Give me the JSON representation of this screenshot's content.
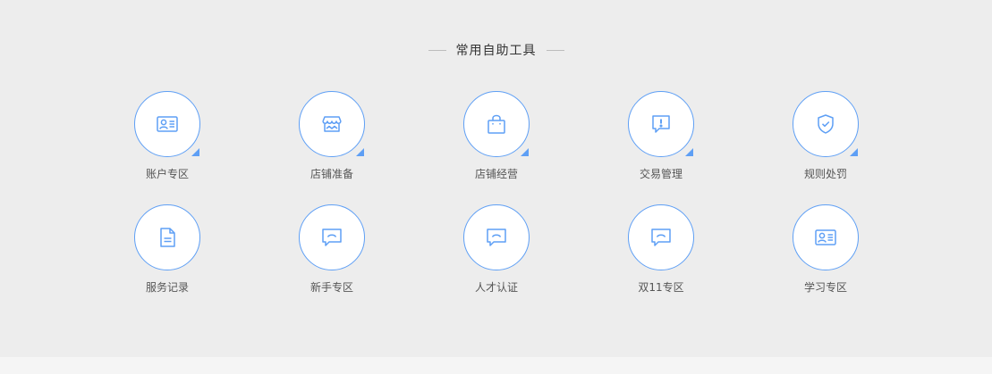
{
  "section": {
    "title": "常用自助工具"
  },
  "colors": {
    "accent": "#5e9ff5",
    "background": "#ededed"
  },
  "tools": [
    {
      "label": "账户专区",
      "icon": "id-card-icon",
      "has_corner": true
    },
    {
      "label": "店铺准备",
      "icon": "storefront-icon",
      "has_corner": true
    },
    {
      "label": "店铺经营",
      "icon": "shopping-bag-icon",
      "has_corner": true
    },
    {
      "label": "交易管理",
      "icon": "alert-message-icon",
      "has_corner": true
    },
    {
      "label": "规则处罚",
      "icon": "shield-check-icon",
      "has_corner": true
    },
    {
      "label": "服务记录",
      "icon": "document-icon",
      "has_corner": false
    },
    {
      "label": "新手专区",
      "icon": "chat-bubble-icon",
      "has_corner": false
    },
    {
      "label": "人才认证",
      "icon": "chat-bubble-icon",
      "has_corner": false
    },
    {
      "label": "双11专区",
      "icon": "chat-bubble-icon",
      "has_corner": false
    },
    {
      "label": "学习专区",
      "icon": "id-card-icon",
      "has_corner": false
    }
  ]
}
